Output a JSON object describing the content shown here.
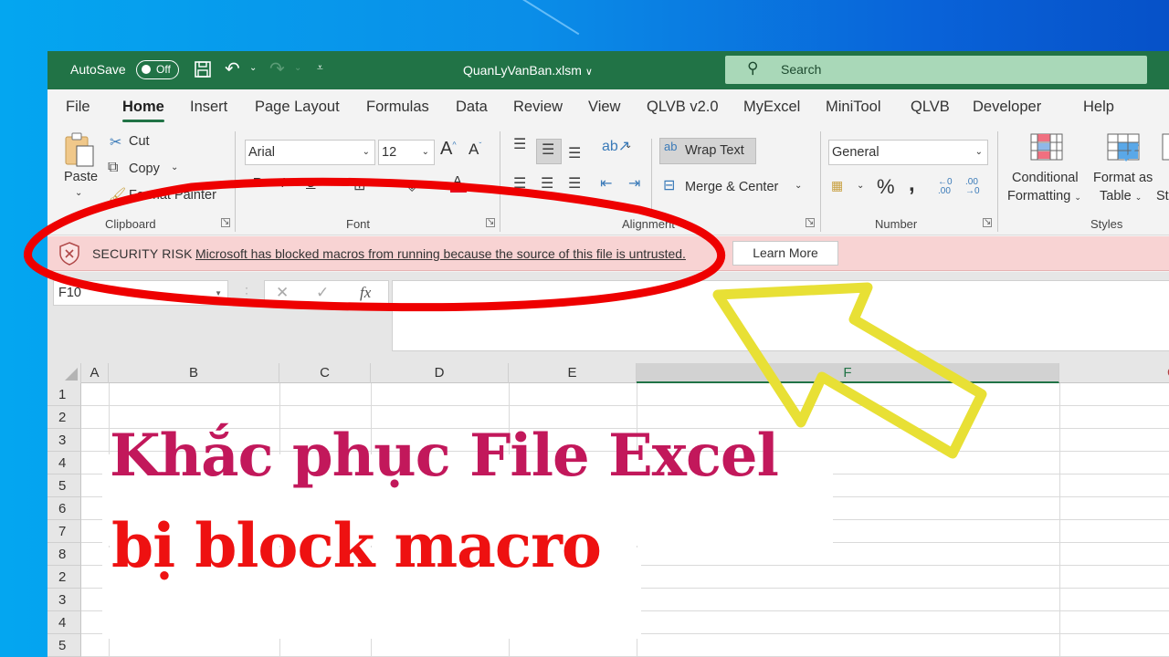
{
  "titlebar": {
    "autosave_label": "AutoSave",
    "autosave_state": "Off",
    "filename": "QuanLyVanBan.xlsm",
    "search_placeholder": "Search",
    "colors": {
      "titlebar_bg": "#217346",
      "search_bg": "#a9d8b8"
    }
  },
  "tabs": [
    {
      "label": "File",
      "active": false
    },
    {
      "label": "Home",
      "active": true
    },
    {
      "label": "Insert",
      "active": false
    },
    {
      "label": "Page Layout",
      "active": false
    },
    {
      "label": "Formulas",
      "active": false
    },
    {
      "label": "Data",
      "active": false
    },
    {
      "label": "Review",
      "active": false
    },
    {
      "label": "View",
      "active": false
    },
    {
      "label": "QLVB v2.0",
      "active": false
    },
    {
      "label": "MyExcel",
      "active": false
    },
    {
      "label": "MiniTool",
      "active": false
    },
    {
      "label": "QLVB",
      "active": false
    },
    {
      "label": "Developer",
      "active": false
    },
    {
      "label": "Help",
      "active": false
    }
  ],
  "ribbon": {
    "clipboard": {
      "label": "Clipboard",
      "paste": "Paste",
      "cut": "Cut",
      "copy": "Copy",
      "format_painter": "Format Painter"
    },
    "font": {
      "label": "Font",
      "font_name": "Arial",
      "font_size": "12"
    },
    "alignment": {
      "label": "Alignment",
      "wrap_text": "Wrap Text",
      "merge_center": "Merge & Center"
    },
    "number": {
      "label": "Number",
      "format": "General"
    },
    "styles": {
      "label": "Styles",
      "conditional_formatting": [
        "Conditional",
        "Formatting"
      ],
      "format_as_table": [
        "Format as",
        "Table"
      ],
      "cell_styles_partial": "St"
    }
  },
  "security_bar": {
    "title": "SECURITY RISK",
    "message": "Microsoft has blocked macros from running because the source of this file is untrusted.",
    "button": "Learn More",
    "bg_color": "#f8d3d3"
  },
  "formula_bar": {
    "name_box": "F10",
    "cancel": "✕",
    "enter": "✓",
    "fx": "fx",
    "formula_value": ""
  },
  "grid": {
    "columns": [
      "A",
      "B",
      "C",
      "D",
      "E",
      "F",
      "G"
    ],
    "selected_column": "F",
    "row_labels": [
      "1",
      "2",
      "3",
      "4",
      "5",
      "6",
      "7",
      "8",
      "2",
      "3",
      "4",
      "5"
    ]
  },
  "overlay": {
    "line1": "Khắc phục File Excel",
    "line2": "bị block macro",
    "line1_color": "#c2185b",
    "line2_color": "#ee1111",
    "annotation_circle_color": "#ee0000",
    "annotation_arrow_color": "#e8e035"
  }
}
